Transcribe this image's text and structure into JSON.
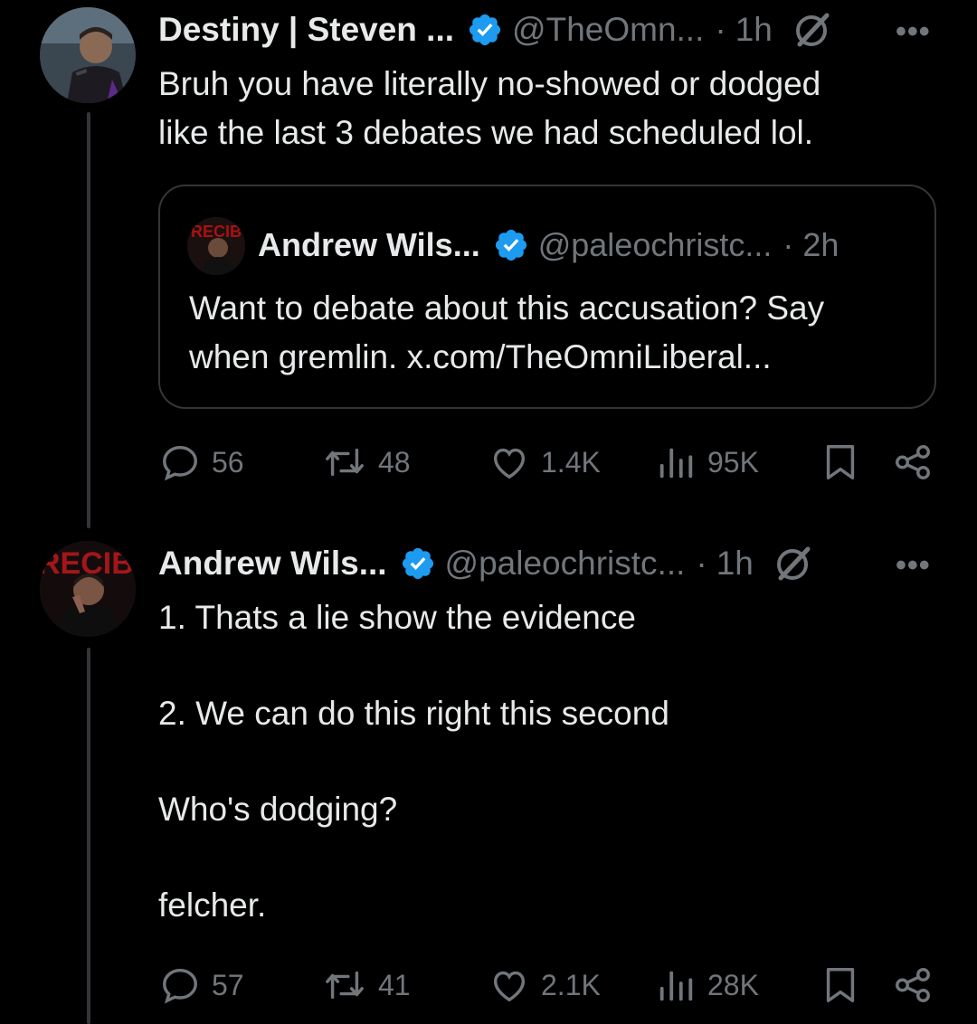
{
  "tweets": [
    {
      "author_name": "Destiny | Steven ...",
      "handle": "@TheOmn...",
      "time": "1h",
      "text": "Bruh you have literally no-showed or dodged\nlike the last 3 debates we had scheduled lol.",
      "quote": {
        "author_name": "Andrew Wils...",
        "handle": "@paleochristc...",
        "time": "2h",
        "text": "Want to debate about this accusation? Say\nwhen gremlin. x.com/TheOmniLiberal..."
      },
      "stats": {
        "replies": "56",
        "reposts": "48",
        "likes": "1.4K",
        "views": "95K"
      }
    },
    {
      "author_name": "Andrew Wils...",
      "handle": "@paleochristc...",
      "time": "1h",
      "text": "1. Thats a lie show the evidence\n\n2. We can do this right this second\n\nWho's dodging?\n\nfelcher.",
      "stats": {
        "replies": "57",
        "reposts": "41",
        "likes": "2.1K",
        "views": "28K"
      }
    }
  ],
  "separator": "·",
  "colors": {
    "background": "#000000",
    "text": "#e7e9ea",
    "muted": "#71767b",
    "verified": "#1d9bf0",
    "border": "#333639"
  },
  "icons": [
    "verified-badge-icon",
    "grok-icon",
    "more-icon",
    "reply-icon",
    "repost-icon",
    "like-icon",
    "views-icon",
    "bookmark-icon",
    "share-icon"
  ]
}
